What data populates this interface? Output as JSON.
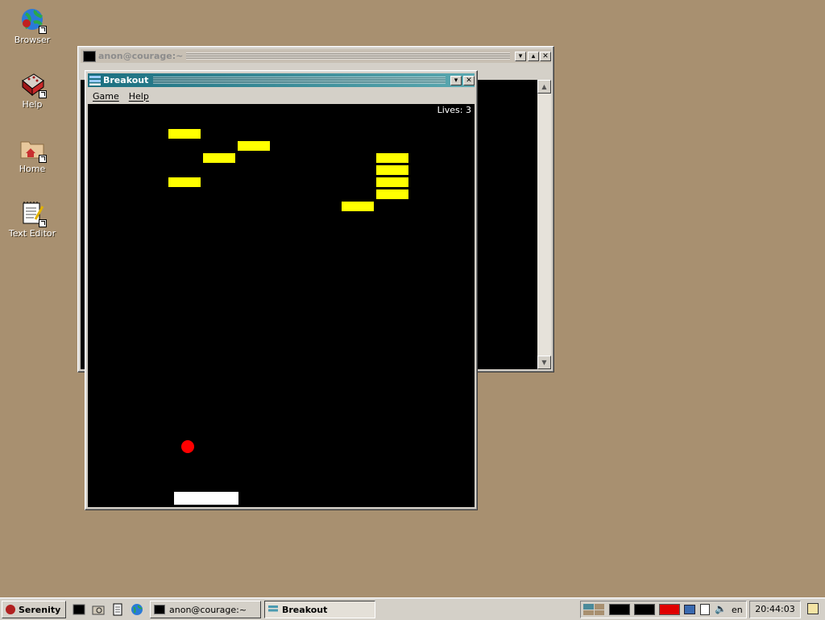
{
  "desktop": {
    "icons": [
      {
        "label": "Browser",
        "icon": "globe-icon"
      },
      {
        "label": "Help",
        "icon": "book-icon"
      },
      {
        "label": "Home",
        "icon": "folder-home-icon"
      },
      {
        "label": "Text Editor",
        "icon": "notepad-icon"
      }
    ]
  },
  "terminal_window": {
    "title": "anon@courage:~"
  },
  "breakout_window": {
    "title": "Breakout",
    "menu": [
      "Game",
      "Help"
    ],
    "lives_text": "Lives: 3",
    "colors": {
      "brick": "#ffff00",
      "ball": "#ff0000",
      "paddle": "#ffffff",
      "background": "#000000"
    }
  },
  "taskbar": {
    "start_label": "Serenity",
    "quick_launch": [
      "terminal-icon",
      "file-manager-icon",
      "text-editor-icon",
      "browser-icon"
    ],
    "tasks": [
      {
        "label": "anon@courage:~",
        "active": false
      },
      {
        "label": "Breakout",
        "active": true
      }
    ],
    "tray": {
      "keymap": "en",
      "clock": "20:44:03"
    }
  }
}
